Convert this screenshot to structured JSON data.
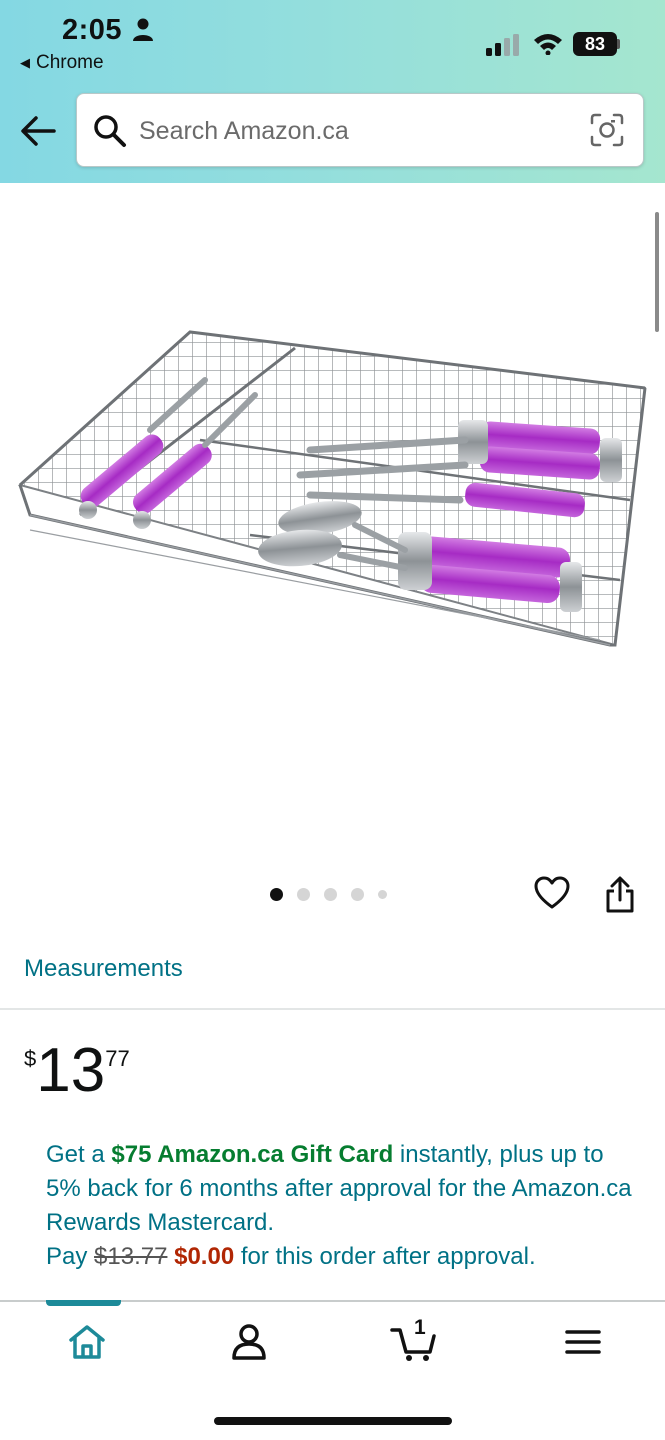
{
  "status_bar": {
    "time": "2:05",
    "back_app": "Chrome",
    "battery": "83"
  },
  "search": {
    "placeholder": "Search Amazon.ca"
  },
  "product": {
    "image_dots_count": 5,
    "image_dot_active": 1,
    "measurements_link": "Measurements",
    "price": {
      "currency": "$",
      "whole": "13",
      "fraction": "77"
    }
  },
  "promo": {
    "line1_prefix": "Get a ",
    "gift_card": "$75 Amazon.ca Gift Card",
    "line1_suffix": " instantly, plus up to 5% back for 6 months after approval for the Amazon.ca Rewards Mastercard.",
    "pay_label": "Pay ",
    "old_price": "$13.77",
    "new_price": "$0.00",
    "pay_suffix": " for this order after approval."
  },
  "tabbar": {
    "cart_count": "1",
    "active_tab": "home"
  },
  "colors": {
    "link": "#007185",
    "green": "#067d30",
    "deal_red": "#b12704",
    "handle_purple": "#b03ac8"
  }
}
